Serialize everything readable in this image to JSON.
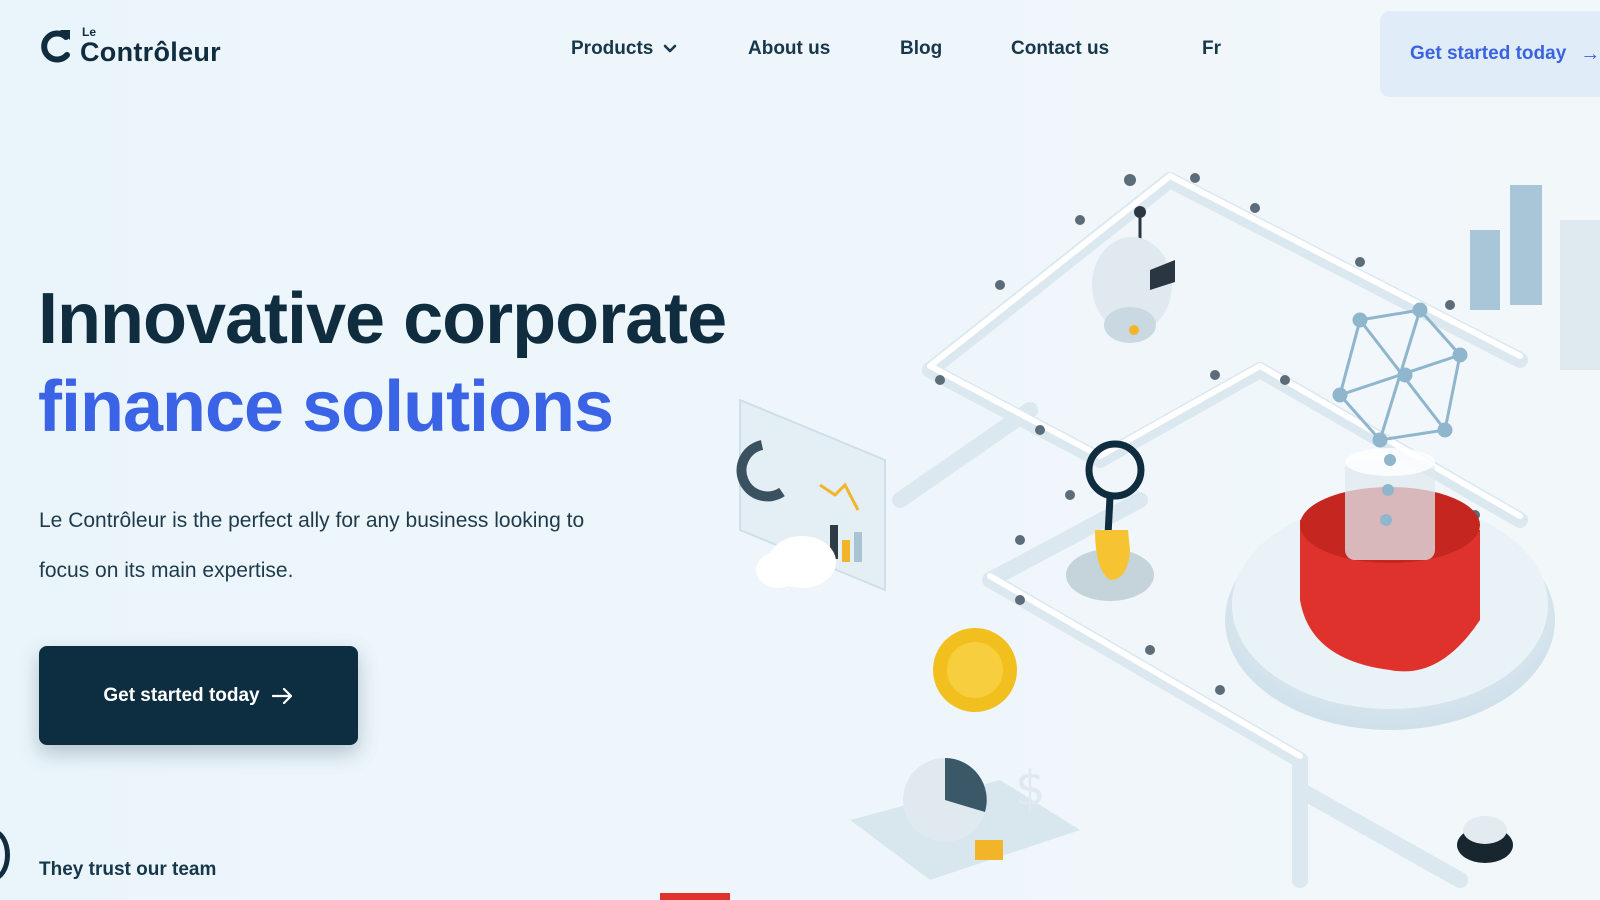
{
  "brand": {
    "small": "Le",
    "name": "Contrôleur"
  },
  "nav": {
    "products": "Products",
    "about": "About us",
    "blog": "Blog",
    "contact": "Contact us",
    "lang": "Fr",
    "cta": "Get started today"
  },
  "hero": {
    "title_line1": "Innovative corporate",
    "title_line2": "finance solutions",
    "description": "Le Contrôleur is the perfect ally for any business looking to focus on its main expertise.",
    "cta": "Get started today"
  },
  "trust": "They trust our team",
  "colors": {
    "brand_dark": "#0f2d3f",
    "accent_blue": "#3a63e6",
    "background": "#eef6fb",
    "red": "#e0322c",
    "yellow": "#f7c531"
  },
  "icons": [
    "logo-icon",
    "chevron-down-icon",
    "arrow-right-icon"
  ]
}
